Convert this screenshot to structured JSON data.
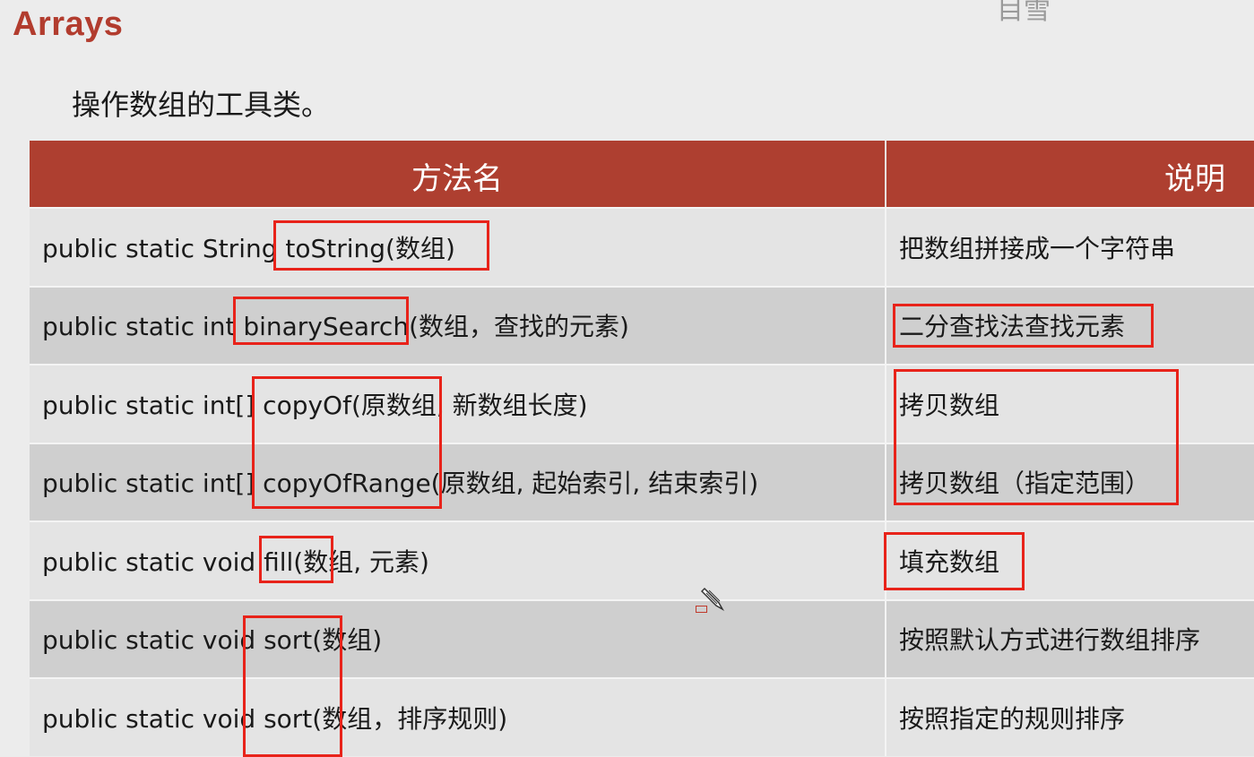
{
  "title": "Arrays",
  "corner_text": "目雪",
  "subtitle": "操作数组的工具类。",
  "table": {
    "headers": {
      "method": "方法名",
      "description": "说明"
    },
    "rows": [
      {
        "method": "public static String toString(数组)",
        "description": "把数组拼接成一个字符串"
      },
      {
        "method": "public static int binarySearch(数组，查找的元素)",
        "description": "二分查找法查找元素"
      },
      {
        "method": "public static int[] copyOf(原数组, 新数组长度)",
        "description": "拷贝数组"
      },
      {
        "method": "public static int[] copyOfRange(原数组, 起始索引, 结束索引)",
        "description": "拷贝数组（指定范围）"
      },
      {
        "method": "public static void fill(数组, 元素)",
        "description": "填充数组"
      },
      {
        "method": "public static void sort(数组)",
        "description": "按照默认方式进行数组排序"
      },
      {
        "method": "public static void sort(数组，排序规则)",
        "description": "按照指定的规则排序"
      }
    ]
  },
  "colors": {
    "accent": "#ae3f30",
    "highlight": "#e8231a"
  },
  "icons": {
    "cursor": "pen-cursor-icon"
  }
}
